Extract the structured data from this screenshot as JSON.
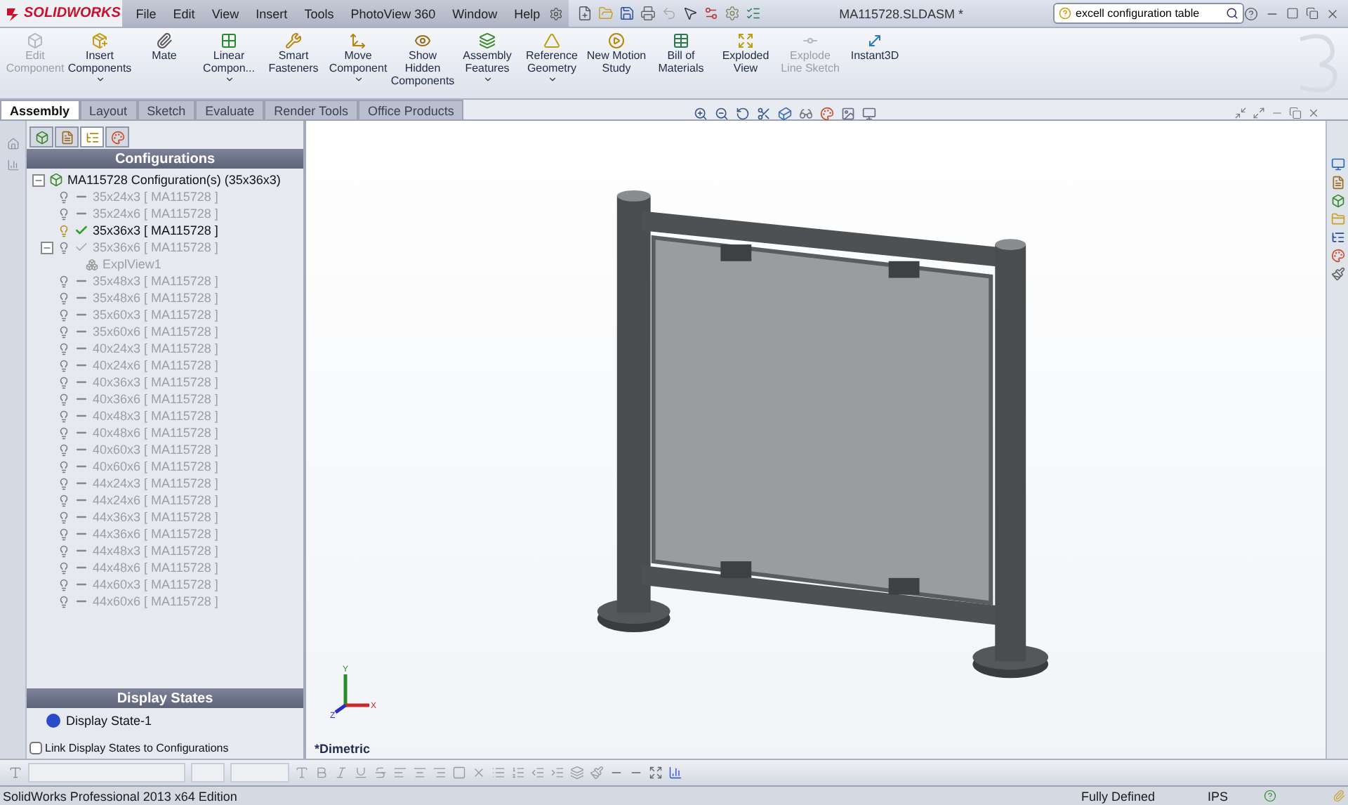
{
  "app": {
    "logo": "SOLIDWORKS",
    "title": "MA115728.SLDASM *"
  },
  "menus": [
    "File",
    "Edit",
    "View",
    "Insert",
    "Tools",
    "PhotoView 360",
    "Window",
    "Help"
  ],
  "search": {
    "value": "excell configuration table"
  },
  "commands": [
    {
      "label": "Edit Component",
      "disabled": true,
      "dropdown": false
    },
    {
      "label": "Insert Components",
      "disabled": false,
      "dropdown": true
    },
    {
      "label": "Mate",
      "disabled": false,
      "dropdown": false
    },
    {
      "label": "Linear Compon...",
      "disabled": false,
      "dropdown": true
    },
    {
      "label": "Smart Fasteners",
      "disabled": false,
      "dropdown": false
    },
    {
      "label": "Move Component",
      "disabled": false,
      "dropdown": true
    },
    {
      "label": "Show Hidden Components",
      "disabled": false,
      "dropdown": false
    },
    {
      "label": "Assembly Features",
      "disabled": false,
      "dropdown": true
    },
    {
      "label": "Reference Geometry",
      "disabled": false,
      "dropdown": true
    },
    {
      "label": "New Motion Study",
      "disabled": false,
      "dropdown": false
    },
    {
      "label": "Bill of Materials",
      "disabled": false,
      "dropdown": false
    },
    {
      "label": "Exploded View",
      "disabled": false,
      "dropdown": false
    },
    {
      "label": "Explode Line Sketch",
      "disabled": true,
      "dropdown": false
    },
    {
      "label": "Instant3D",
      "disabled": false,
      "dropdown": false
    }
  ],
  "tabs": [
    {
      "label": "Assembly",
      "selected": true
    },
    {
      "label": "Layout",
      "selected": false
    },
    {
      "label": "Sketch",
      "selected": false
    },
    {
      "label": "Evaluate",
      "selected": false
    },
    {
      "label": "Render Tools",
      "selected": false
    },
    {
      "label": "Office Products",
      "selected": false
    }
  ],
  "panel_tabs": [
    {
      "selected": false
    },
    {
      "selected": false
    },
    {
      "selected": true
    },
    {
      "selected": false
    }
  ],
  "configurations": {
    "title": "Configurations",
    "root": {
      "label": "MA115728 Configuration(s)  (35x36x3)",
      "expanded": true
    },
    "items": [
      {
        "label": "35x24x3 [ MA115728 ]",
        "active": false
      },
      {
        "label": "35x24x6 [ MA115728 ]",
        "active": false
      },
      {
        "label": "35x36x3 [ MA115728 ]",
        "active": true
      },
      {
        "label": "35x36x6 [ MA115728 ]",
        "active": false,
        "expanded": true,
        "children": [
          {
            "label": "ExplView1"
          }
        ]
      },
      {
        "label": "35x48x3 [ MA115728 ]",
        "active": false
      },
      {
        "label": "35x48x6 [ MA115728 ]",
        "active": false
      },
      {
        "label": "35x60x3 [ MA115728 ]",
        "active": false
      },
      {
        "label": "35x60x6 [ MA115728 ]",
        "active": false
      },
      {
        "label": "40x24x3 [ MA115728 ]",
        "active": false
      },
      {
        "label": "40x24x6 [ MA115728 ]",
        "active": false
      },
      {
        "label": "40x36x3 [ MA115728 ]",
        "active": false
      },
      {
        "label": "40x36x6 [ MA115728 ]",
        "active": false
      },
      {
        "label": "40x48x3 [ MA115728 ]",
        "active": false
      },
      {
        "label": "40x48x6 [ MA115728 ]",
        "active": false
      },
      {
        "label": "40x60x3 [ MA115728 ]",
        "active": false
      },
      {
        "label": "40x60x6 [ MA115728 ]",
        "active": false
      },
      {
        "label": "44x24x3 [ MA115728 ]",
        "active": false
      },
      {
        "label": "44x24x6 [ MA115728 ]",
        "active": false
      },
      {
        "label": "44x36x3 [ MA115728 ]",
        "active": false
      },
      {
        "label": "44x36x6 [ MA115728 ]",
        "active": false
      },
      {
        "label": "44x48x3 [ MA115728 ]",
        "active": false
      },
      {
        "label": "44x48x6 [ MA115728 ]",
        "active": false
      },
      {
        "label": "44x60x3 [ MA115728 ]",
        "active": false
      },
      {
        "label": "44x60x6 [ MA115728 ]",
        "active": false
      }
    ]
  },
  "display_states": {
    "title": "Display States",
    "items": [
      "Display State-1"
    ],
    "link_label": "Link Display States to Configurations",
    "link_checked": false
  },
  "viewport": {
    "view_name": "*Dimetric",
    "triad": [
      "X",
      "Y",
      "Z"
    ]
  },
  "status_bar": {
    "product": "SolidWorks Professional 2013 x64 Edition",
    "state": "Fully Defined",
    "units": "IPS"
  }
}
